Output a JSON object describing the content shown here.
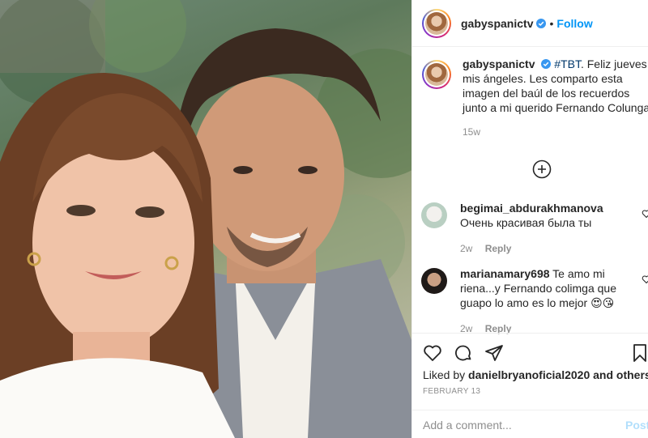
{
  "post": {
    "photo_alt": "",
    "header": {
      "username": "gabyspanictv",
      "separator": "•",
      "follow_label": "Follow"
    },
    "caption": {
      "username": "gabyspanictv",
      "hashtag": "#TBT",
      "text": ". Feliz jueves mis ángeles. Les comparto esta imagen del baúl de los recuerdos junto a mi querido Fernando Colunga.",
      "time": "15w"
    },
    "load_more_icon": "plus-circle-icon",
    "comments": [
      {
        "username": "begimai_abdurakhmanova",
        "text": "Очень красивая была ты",
        "time": "2w",
        "reply_label": "Reply"
      },
      {
        "username": "marianamary698",
        "text": "Te amo mi riena...y Fernando colimga que guapo lo amo es lo mejor 😍😘",
        "time": "2w",
        "reply_label": "Reply"
      }
    ],
    "actions": {
      "liked_by_prefix": "Liked by",
      "liked_by_user": "danielbryanoficial2020",
      "liked_by_suffix": "and others",
      "date": "FEBRUARY 13"
    },
    "comment_input": {
      "placeholder": "Add a comment...",
      "post_label": "Post"
    },
    "colors": {
      "accent": "#0095f6",
      "verified": "#3897f0",
      "hashtag": "#00376b",
      "muted": "#8e8e8e",
      "post_disabled": "#b2dffc"
    }
  }
}
